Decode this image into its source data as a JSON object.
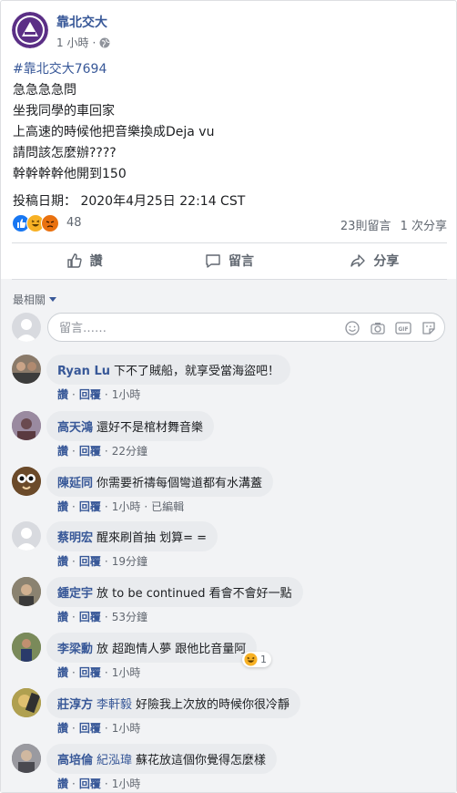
{
  "page": {
    "name": "靠北交大",
    "time": "1 小時",
    "audience_icon": "globe-icon"
  },
  "post": {
    "hashtag": "#靠北交大7694",
    "lines": [
      "急急急急問",
      "坐我同學的車回家",
      "上高速的時候他把音樂換成Deja vu",
      "請問該怎麼辦????",
      "幹幹幹幹他開到150"
    ],
    "date": "投稿日期： 2020年4月25日 22:14 CST"
  },
  "reactions": {
    "icons": [
      "like-reaction-icon",
      "haha-reaction-icon",
      "angry-reaction-icon"
    ],
    "count": "48",
    "comments": "23則留言",
    "shares": "1 次分享"
  },
  "actions": {
    "like": "讚",
    "comment": "留言",
    "share": "分享"
  },
  "comments_section": {
    "sort_label": "最相關",
    "input_placeholder": "留言……"
  },
  "comments": [
    {
      "name": "Ryan Lu",
      "tag": "",
      "text": "下不了賊船，就享受當海盜吧！",
      "like": "讚",
      "reply": "回覆",
      "time": "1小時",
      "extra": "",
      "avatar_color": "#8a7a6a"
    },
    {
      "name": "高天鴻",
      "tag": "",
      "text": "還好不是棺材舞音樂",
      "like": "讚",
      "reply": "回覆",
      "time": "22分鐘",
      "extra": "",
      "avatar_color": "#7d6a80"
    },
    {
      "name": "陳延同",
      "tag": "",
      "text": "你需要祈禱每個彎道都有水溝蓋",
      "like": "讚",
      "reply": "回覆",
      "time": "1小時",
      "extra": "已編輯",
      "avatar_color": "#6b4a2a"
    },
    {
      "name": "蔡明宏",
      "tag": "",
      "text": "醒來刷首抽 划算= =",
      "like": "讚",
      "reply": "回覆",
      "time": "19分鐘",
      "extra": "",
      "avatar_color": "#d8dadf"
    },
    {
      "name": "鍾定宇",
      "tag": "",
      "text": "放 to be continued 看會不會好一點",
      "like": "讚",
      "reply": "回覆",
      "time": "53分鐘",
      "extra": "",
      "avatar_color": "#6d6650"
    },
    {
      "name": "李梁勳",
      "tag": "",
      "text": "放 超跑情人夢 跟他比音量阿",
      "like": "讚",
      "reply": "回覆",
      "time": "1小時",
      "extra": "",
      "avatar_color": "#5e6f4a",
      "reaction_count": "1"
    },
    {
      "name": "莊淳方",
      "tag": "李軒毅",
      "text": "好險我上次放的時候你很冷靜",
      "like": "讚",
      "reply": "回覆",
      "time": "1小時",
      "extra": "",
      "avatar_color": "#8a7a30"
    },
    {
      "name": "高培倫",
      "tag": "紀泓瑋",
      "text": "蘇花放這個你覺得怎麼樣",
      "like": "讚",
      "reply": "回覆",
      "time": "1小時",
      "extra": "",
      "avatar_color": "#6a6a70"
    }
  ]
}
